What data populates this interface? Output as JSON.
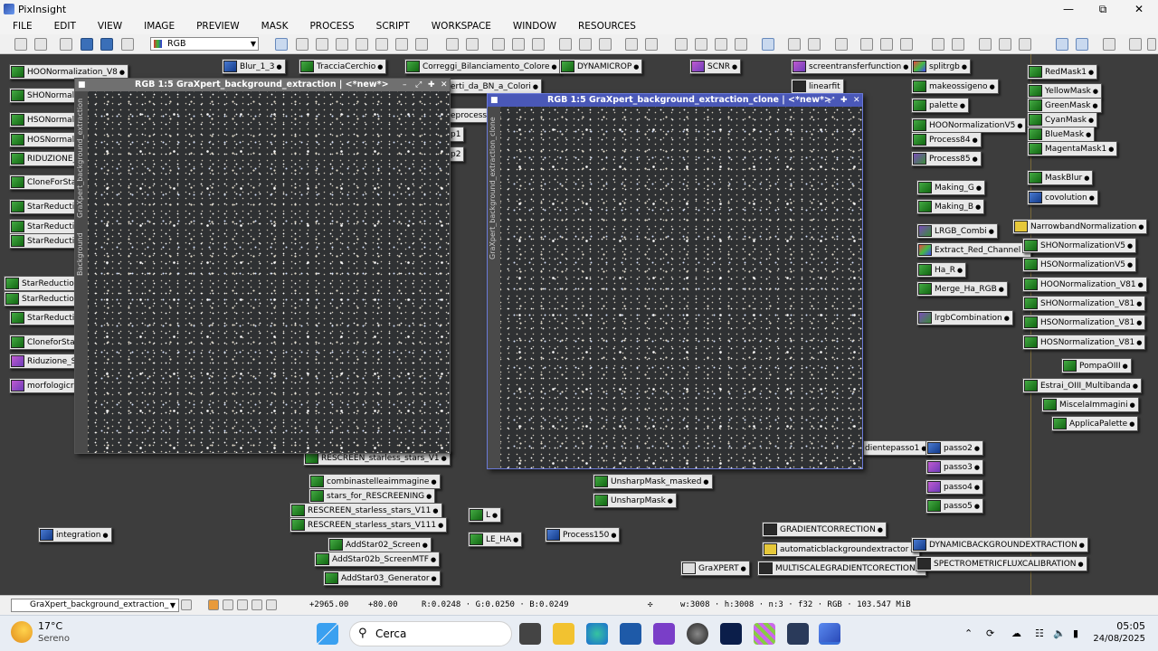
{
  "app": {
    "title": "PixInsight"
  },
  "menu": [
    "FILE",
    "EDIT",
    "VIEW",
    "IMAGE",
    "PREVIEW",
    "MASK",
    "PROCESS",
    "SCRIPT",
    "WORKSPACE",
    "WINDOW",
    "RESOURCES"
  ],
  "toolbar": {
    "color_space": "RGB"
  },
  "windows": {
    "main": {
      "title": "RGB 1:5 GraXpert_background_extraction | <*new*>",
      "side_tab": "GraXpert_background_extraction",
      "side_tab2": "Background",
      "bottom_label": "Background"
    },
    "clone": {
      "title": "RGB 1:5 GraXpert_background_extraction_clone | <*new*>",
      "side_tab": "GraXpert_background_extraction_clone"
    }
  },
  "process_icons": [
    {
      "label": "HOONormalization_V8"
    },
    {
      "label": "SHONormaliz"
    },
    {
      "label": "HSONormaliz"
    },
    {
      "label": "HOSNormaliz"
    },
    {
      "label": "RIDUZIONE_"
    },
    {
      "label": "CloneForSta"
    },
    {
      "label": "StarReductio"
    },
    {
      "label": "StarReductio"
    },
    {
      "label": "StarReductio"
    },
    {
      "label": "StarReduction"
    },
    {
      "label": "StarReduction"
    },
    {
      "label": "StarReductio"
    },
    {
      "label": "CloneforStar"
    },
    {
      "label": "Riduzione_St"
    },
    {
      "label": "morfologicra"
    },
    {
      "label": "integration"
    },
    {
      "label": "Blur_1_3"
    },
    {
      "label": "TracciaCerchio"
    },
    {
      "label": "Correggi_Bilanciamento_Colore"
    },
    {
      "label": "DYNAMICROP"
    },
    {
      "label": "SCNR"
    },
    {
      "label": "screentransferfunction"
    },
    {
      "label": "linearfit"
    },
    {
      "label": "erti_da_BN_a_Colori"
    },
    {
      "label": "eprocess"
    },
    {
      "label": "p1"
    },
    {
      "label": "p2"
    },
    {
      "label": "RESCREEN_starless_stars_V1"
    },
    {
      "label": "combinastelleaimmagine"
    },
    {
      "label": "stars_for_RESCREENING"
    },
    {
      "label": "RESCREEN_starless_stars_V11"
    },
    {
      "label": "RESCREEN_starless_stars_V111"
    },
    {
      "label": "AddStar02_Screen"
    },
    {
      "label": "AddStar02b_ScreenMTF"
    },
    {
      "label": "AddStar03_Generator"
    },
    {
      "label": "L"
    },
    {
      "label": "LE_HA"
    },
    {
      "label": "Process150"
    },
    {
      "label": "UnsharpMask_masked"
    },
    {
      "label": "UnsharpMask"
    },
    {
      "label": "GraXPERT"
    },
    {
      "label": "GRADIENTCORRECTION"
    },
    {
      "label": "automaticblackgroundextractor"
    },
    {
      "label": "MULTISCALEGRADIENTCORECTION"
    },
    {
      "label": "dientepasso1"
    },
    {
      "label": "passo2"
    },
    {
      "label": "passo3"
    },
    {
      "label": "passo4"
    },
    {
      "label": "passo5"
    },
    {
      "label": "DYNAMICBACKGROUNDEXTRACTION"
    },
    {
      "label": "SPECTROMETRICFLUXCALIBRATION"
    },
    {
      "label": "splitrgb"
    },
    {
      "label": "makeossigeno"
    },
    {
      "label": "palette"
    },
    {
      "label": "HOONormalizationV5"
    },
    {
      "label": "Process84"
    },
    {
      "label": "Process85"
    },
    {
      "label": "Making_G"
    },
    {
      "label": "Making_B"
    },
    {
      "label": "LRGB_Combi"
    },
    {
      "label": "Extract_Red_Channel"
    },
    {
      "label": "Ha_R"
    },
    {
      "label": "Merge_Ha_RGB"
    },
    {
      "label": "lrgbCombination"
    },
    {
      "label": "RedMask1"
    },
    {
      "label": "YellowMask"
    },
    {
      "label": "GreenMask"
    },
    {
      "label": "CyanMask"
    },
    {
      "label": "BlueMask"
    },
    {
      "label": "MagentaMask1"
    },
    {
      "label": "MaskBlur"
    },
    {
      "label": "covolution"
    },
    {
      "label": "NarrowbandNormalization"
    },
    {
      "label": "SHONormalizationV5"
    },
    {
      "label": "HSONormalizationV5"
    },
    {
      "label": "HOONormalization_V81"
    },
    {
      "label": "SHONormalization_V81"
    },
    {
      "label": "HSONormalization_V81"
    },
    {
      "label": "HOSNormalization_V81"
    },
    {
      "label": "PompaOIII"
    },
    {
      "label": "Estrai_OIII_Multibanda"
    },
    {
      "label": "MiscelaImmagini"
    },
    {
      "label": "ApplicaPalette"
    }
  ],
  "status": {
    "view": "GraXpert_background_extraction_",
    "zoom_x": "+2965.00",
    "zoom_y": "+80.00",
    "rgb": "R:0.0248 · G:0.0250 · B:0.0249",
    "info": "w:3008 · h:3008 · n:3 · f32 · RGB · 103.547 MiB"
  },
  "taskbar": {
    "weather_temp": "17°C",
    "weather_desc": "Sereno",
    "search_placeholder": "Cerca",
    "time": "05:05",
    "date": "24/08/2025"
  }
}
